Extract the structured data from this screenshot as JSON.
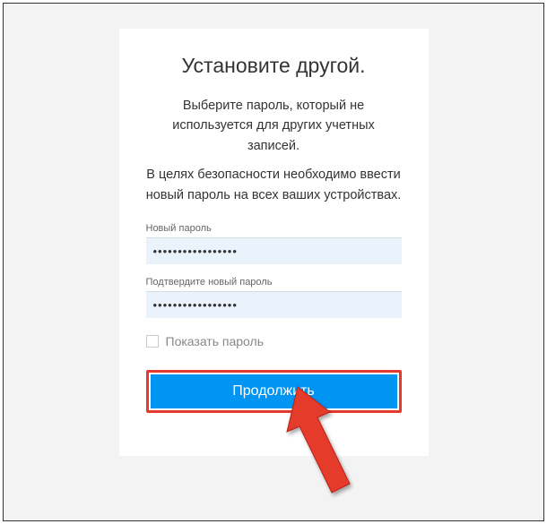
{
  "dialog": {
    "title": "Установите другой.",
    "description_line1": "Выберите пароль, который не используется для других учетных записей.",
    "description_line2": "В целях безопасности необходимо ввести новый пароль на всех ваших устройствах.",
    "new_password": {
      "label": "Новый пароль",
      "value": "•••••••••••••••••"
    },
    "confirm_password": {
      "label": "Подтвердите новый пароль",
      "value": "•••••••••••••••••"
    },
    "show_password_label": "Показать пароль",
    "continue_label": "Продолжить"
  },
  "annotation": {
    "highlight_color": "#e53a2b",
    "arrow_color": "#e53a2b"
  }
}
